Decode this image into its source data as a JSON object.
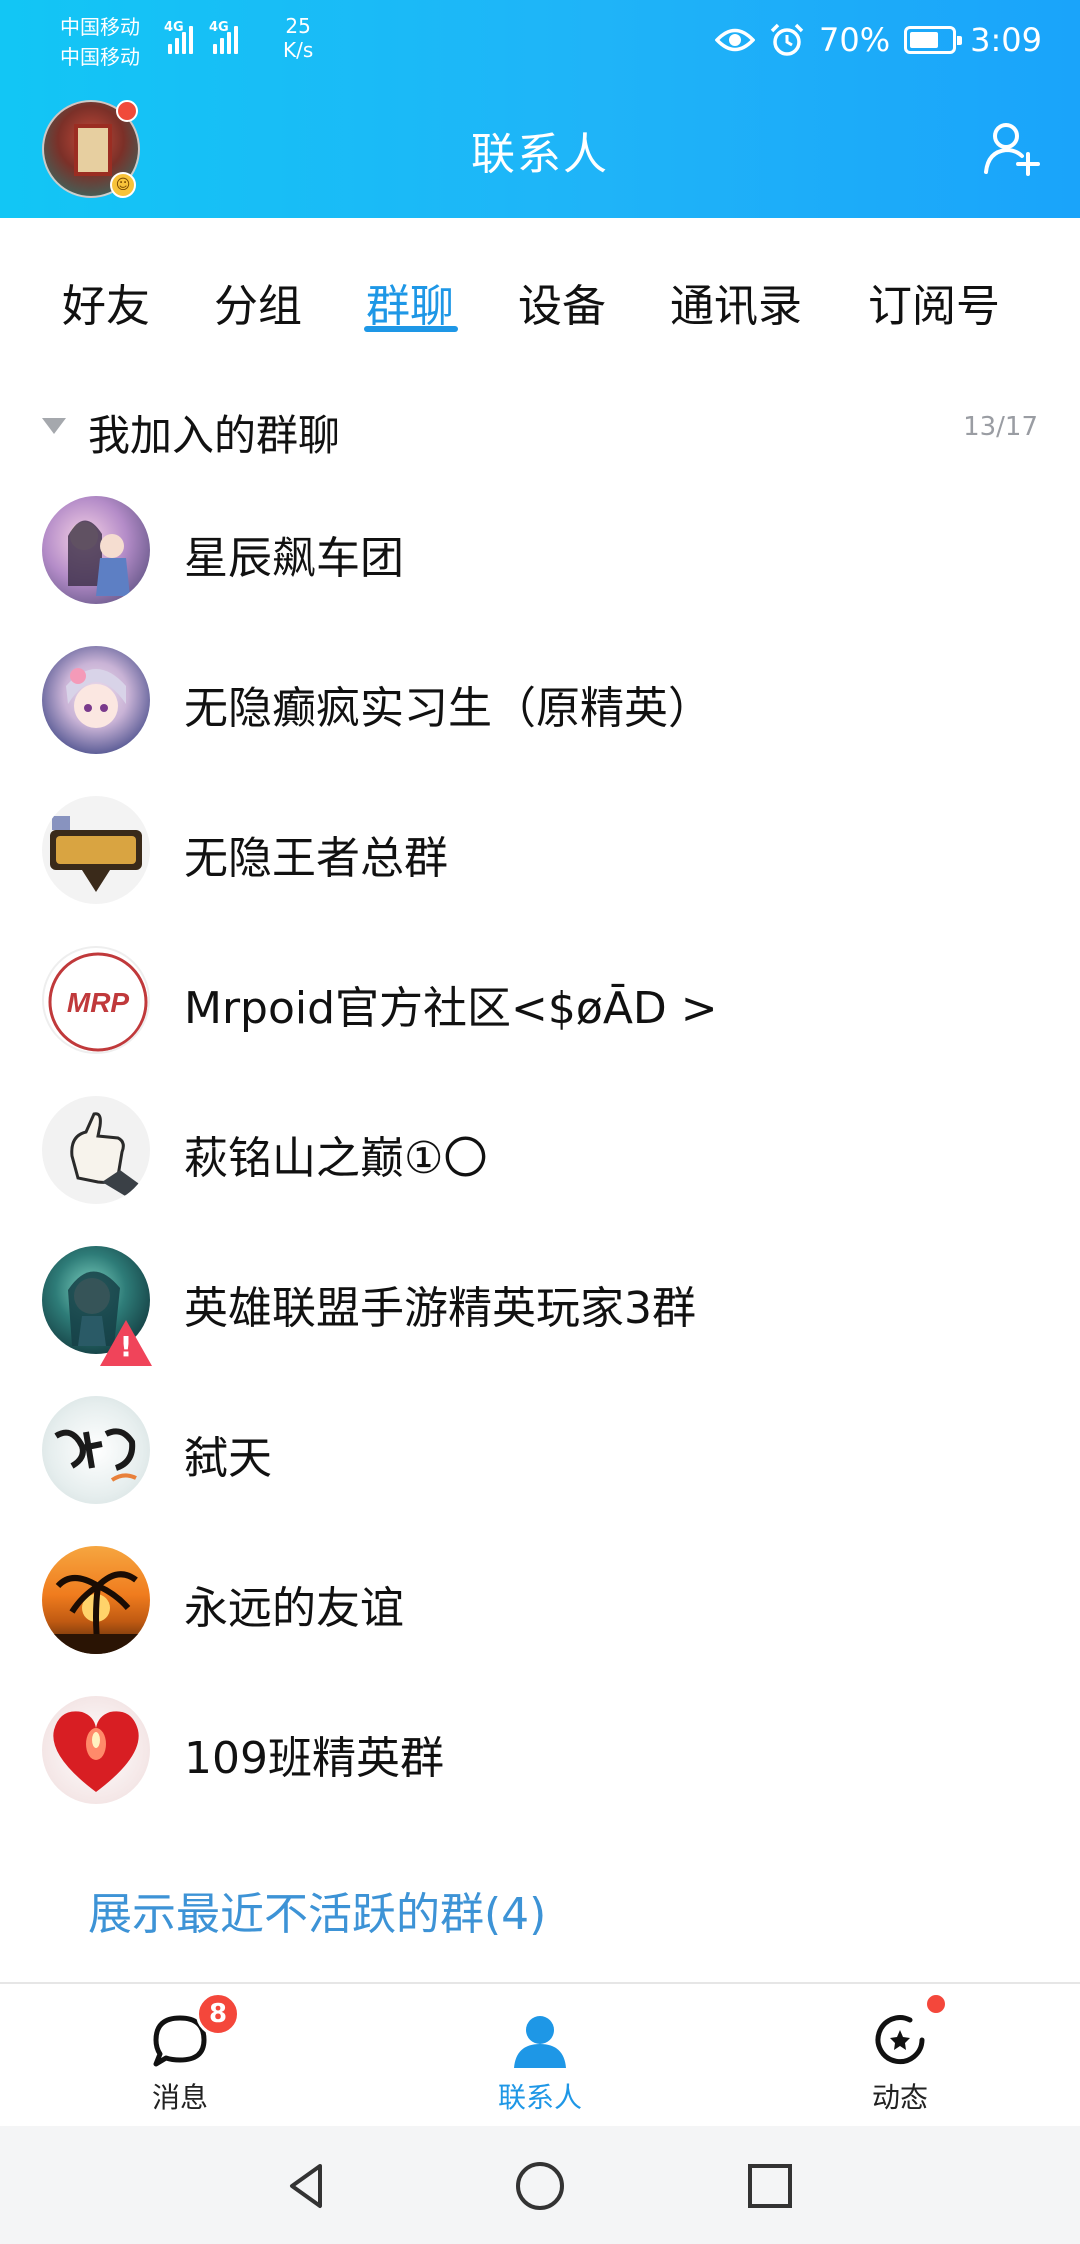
{
  "status_bar": {
    "carrier_1": "中国移动",
    "carrier_2": "中国移动",
    "net_type": "4G",
    "net_speed_value": "25",
    "net_speed_unit": "K/s",
    "battery_text": "70%",
    "battery_level": 0.7,
    "time": "3:09",
    "icons": [
      "eye-icon",
      "alarm-icon",
      "battery-icon"
    ]
  },
  "header": {
    "title": "联系人",
    "add_friend_icon": "add-person-icon"
  },
  "tabs": [
    {
      "label": "好友",
      "active": false
    },
    {
      "label": "分组",
      "active": false
    },
    {
      "label": "群聊",
      "active": true
    },
    {
      "label": "设备",
      "active": false
    },
    {
      "label": "通讯录",
      "active": false
    },
    {
      "label": "订阅号",
      "active": false
    }
  ],
  "group_section": {
    "title": "我加入的群聊",
    "count": "13/17",
    "groups": [
      {
        "name": "星辰飙车团",
        "avatar": "anime-girls-avatar"
      },
      {
        "name": "无隐癫疯实习生（原精英）",
        "avatar": "anime-girl-avatar"
      },
      {
        "name": "无隐王者总群",
        "avatar": "game-logo-avatar"
      },
      {
        "name": "Mrpoid官方社区<$øĀD >",
        "avatar": "mrp-logo-avatar"
      },
      {
        "name": "萩铭山之巅①〇",
        "avatar": "thumbs-up-avatar"
      },
      {
        "name": "英雄联盟手游精英玩家3群",
        "avatar": "game-character-avatar",
        "warning": true
      },
      {
        "name": "弑天",
        "avatar": "calligraphy-avatar"
      },
      {
        "name": "永远的友谊",
        "avatar": "sunset-palm-avatar"
      },
      {
        "name": "109班精英群",
        "avatar": "red-heart-avatar"
      }
    ],
    "show_inactive": "展示最近不活跃的群(4)"
  },
  "bottom_nav": [
    {
      "label": "消息",
      "icon": "chat-bubble-icon",
      "badge": "8",
      "active": false
    },
    {
      "label": "联系人",
      "icon": "person-icon",
      "active": true
    },
    {
      "label": "动态",
      "icon": "star-refresh-icon",
      "dot": true,
      "active": false
    }
  ],
  "system_nav": [
    "back-icon",
    "home-icon",
    "recents-icon"
  ],
  "colors": {
    "accent": "#1e97e6",
    "header_gradient_start": "#12c6f5",
    "header_gradient_end": "#1aa4fa",
    "badge_red": "#f4473b",
    "secondary_text": "#9a9da3"
  }
}
